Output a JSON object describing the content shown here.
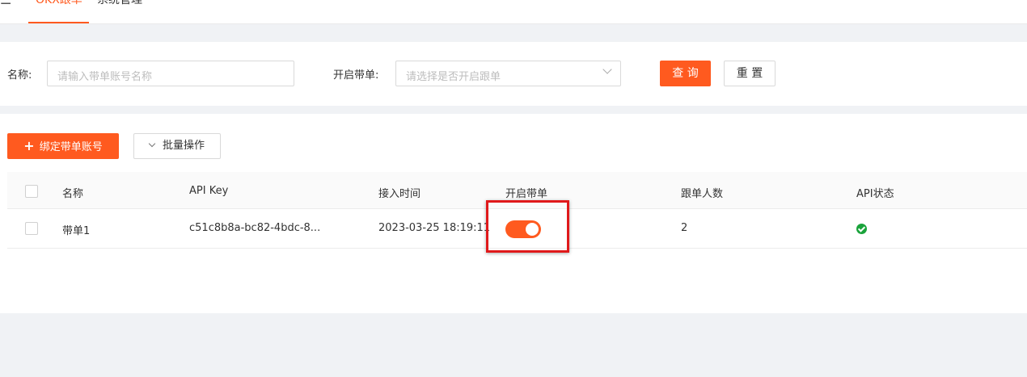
{
  "topnav": {
    "menu_icon": "menu-icon",
    "tabs": [
      {
        "label": "OKX跟单",
        "active": true
      },
      {
        "label": "系统管理",
        "active": false
      }
    ]
  },
  "search": {
    "name_label": "名称:",
    "name_placeholder": "请输入带单账号名称",
    "enable_label": "开启带单:",
    "enable_placeholder": "请选择是否开启跟单",
    "query_button": "查 询",
    "reset_button": "重 置"
  },
  "toolbar": {
    "add_button": "绑定带单账号",
    "batch_button": "批量操作"
  },
  "table": {
    "columns": [
      "名称",
      "API Key",
      "接入时间",
      "开启带单",
      "跟单人数",
      "API状态"
    ],
    "rows": [
      {
        "name": "带单1",
        "api_key": "c51c8b8a-bc82-4bdc-8...",
        "access_time": "2023-03-25 18:19:11",
        "enabled": true,
        "followers": "2",
        "api_status": "ok"
      }
    ]
  },
  "colors": {
    "accent": "#ff5a1f",
    "status_ok": "#1aa33b",
    "highlight": "#e0191b"
  }
}
